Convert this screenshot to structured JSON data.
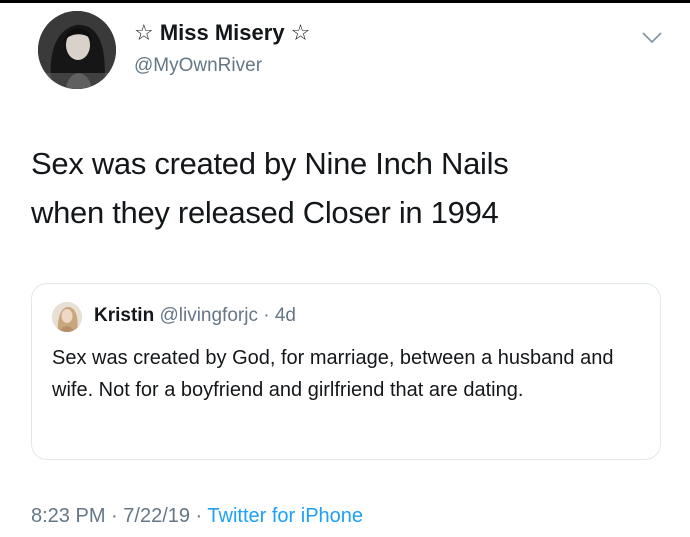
{
  "author": {
    "display_name": "☆ Miss Misery ☆",
    "handle": "@MyOwnRiver"
  },
  "tweet": {
    "line1": "Sex was created by Nine Inch Nails",
    "line2": "when they released Closer in 1994"
  },
  "quoted_tweet": {
    "name": "Kristin",
    "handle": "@livingforjc",
    "separator": " · ",
    "age": "4d",
    "text": "Sex was created by God, for marriage, between a husband and wife. Not for a boyfriend and girlfriend that are dating."
  },
  "footer": {
    "time": "8:23 PM",
    "sep1": " · ",
    "date": "7/22/19",
    "sep2": " · ",
    "source": "Twitter for iPhone"
  },
  "colors": {
    "text": "#14171a",
    "secondary": "#657786",
    "link": "#1da1f2",
    "border": "#e1e8ed"
  },
  "icons": {
    "menu": "chevron-down-icon",
    "avatar": "profile-photo",
    "quote_avatar": "profile-photo"
  }
}
